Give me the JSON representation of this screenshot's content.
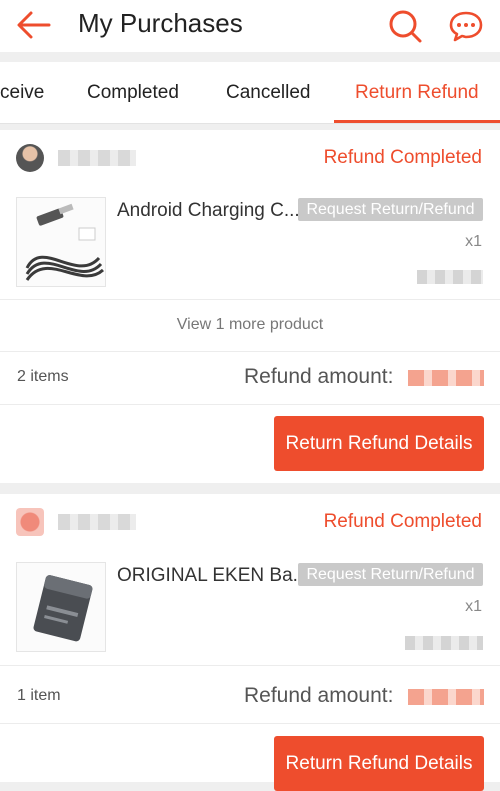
{
  "header": {
    "title": "My Purchases",
    "back_icon": "arrow-left-icon",
    "search_icon": "search-icon",
    "chat_icon": "chat-icon",
    "accent": "#ee4d2d"
  },
  "tabs": [
    {
      "label": "ceive",
      "active": false
    },
    {
      "label": "Completed",
      "active": false
    },
    {
      "label": "Cancelled",
      "active": false
    },
    {
      "label": "Return Refund",
      "active": true
    }
  ],
  "orders": [
    {
      "status": "Refund Completed",
      "product_name": "Android Charging C...",
      "request_label": "Request Return/Refund",
      "quantity": "x1",
      "more_products": "View 1 more product",
      "items_count": "2 items",
      "refund_label": "Refund amount:",
      "details_button": "Return Refund Details"
    },
    {
      "status": "Refund Completed",
      "product_name": "ORIGINAL EKEN Ba...",
      "request_label": "Request Return/Refund",
      "quantity": "x1",
      "items_count": "1 item",
      "refund_label": "Refund amount:",
      "details_button": "Return Refund Details"
    }
  ]
}
